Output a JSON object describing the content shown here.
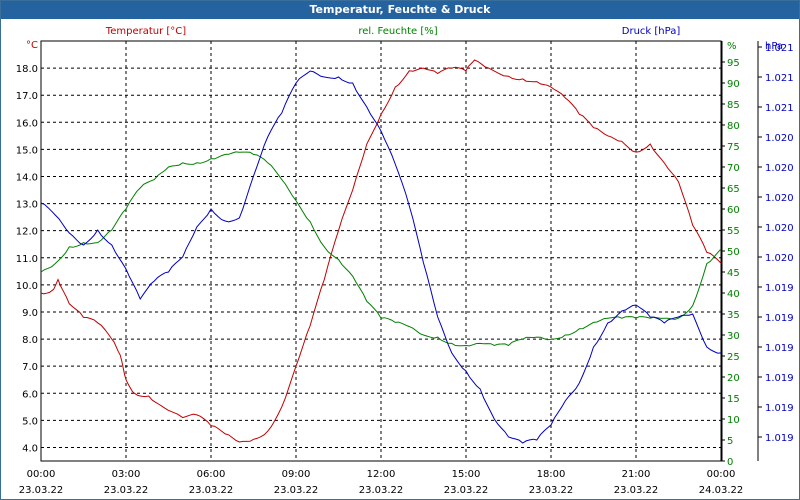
{
  "window": {
    "title": "Temperatur, Feuchte & Druck"
  },
  "chart_data": {
    "type": "line",
    "title": "Temperatur, Feuchte & Druck",
    "x_ticks": [
      {
        "time": "00:00",
        "date": "23.03.22"
      },
      {
        "time": "03:00",
        "date": "23.03.22"
      },
      {
        "time": "06:00",
        "date": "23.03.22"
      },
      {
        "time": "09:00",
        "date": "23.03.22"
      },
      {
        "time": "12:00",
        "date": "23.03.22"
      },
      {
        "time": "15:00",
        "date": "23.03.22"
      },
      {
        "time": "18:00",
        "date": "23.03.22"
      },
      {
        "time": "21:00",
        "date": "23.03.22"
      },
      {
        "time": "00:00",
        "date": "24.03.22"
      }
    ],
    "x_range_hours": [
      0,
      24
    ],
    "axes": {
      "temperature": {
        "unit_label": "°C",
        "ticks": [
          "4.0",
          "5.0",
          "6.0",
          "7.0",
          "8.0",
          "9.0",
          "10.0",
          "11.0",
          "12.0",
          "13.0",
          "14.0",
          "15.0",
          "16.0",
          "17.0",
          "18.0"
        ],
        "range": [
          3.5,
          19.0
        ]
      },
      "humidity": {
        "unit_label": "%",
        "ticks": [
          "0",
          "5",
          "10",
          "15",
          "20",
          "25",
          "30",
          "35",
          "40",
          "45",
          "50",
          "55",
          "60",
          "65",
          "70",
          "75",
          "80",
          "85",
          "90",
          "95"
        ],
        "range": [
          0,
          100
        ]
      },
      "pressure": {
        "unit_label": "hPa",
        "ticks": [
          "1.019",
          "1.019",
          "1.019",
          "1.019",
          "1.019",
          "1.019",
          "1.020",
          "1.020",
          "1.020",
          "1.020",
          "1.020",
          "1.021",
          "1.021",
          "1.021"
        ],
        "range": [
          0,
          14
        ]
      }
    },
    "series": [
      {
        "name": "Temperatur [°C]",
        "color": "#c00000",
        "axis": "temperature",
        "points": [
          [
            0,
            9.7
          ],
          [
            0.4,
            9.8
          ],
          [
            0.6,
            10.2
          ],
          [
            1.0,
            9.3
          ],
          [
            1.5,
            8.8
          ],
          [
            2.0,
            8.6
          ],
          [
            2.5,
            8.0
          ],
          [
            2.8,
            7.4
          ],
          [
            3.0,
            6.5
          ],
          [
            3.3,
            6.0
          ],
          [
            3.8,
            5.9
          ],
          [
            4.3,
            5.5
          ],
          [
            5.0,
            5.1
          ],
          [
            5.5,
            5.2
          ],
          [
            6.0,
            4.8
          ],
          [
            6.5,
            4.5
          ],
          [
            7.0,
            4.2
          ],
          [
            7.5,
            4.3
          ],
          [
            8.0,
            4.6
          ],
          [
            8.5,
            5.5
          ],
          [
            9.0,
            7.0
          ],
          [
            9.5,
            8.5
          ],
          [
            10.0,
            10.2
          ],
          [
            10.5,
            12.0
          ],
          [
            11.0,
            13.5
          ],
          [
            11.5,
            15.2
          ],
          [
            12.0,
            16.3
          ],
          [
            12.5,
            17.3
          ],
          [
            13.0,
            17.9
          ],
          [
            13.5,
            18.0
          ],
          [
            14.0,
            17.8
          ],
          [
            14.5,
            18.0
          ],
          [
            15.0,
            17.9
          ],
          [
            15.3,
            18.3
          ],
          [
            15.8,
            18.0
          ],
          [
            16.5,
            17.7
          ],
          [
            17.0,
            17.6
          ],
          [
            17.5,
            17.5
          ],
          [
            18.0,
            17.3
          ],
          [
            18.5,
            16.9
          ],
          [
            19.0,
            16.3
          ],
          [
            19.5,
            15.8
          ],
          [
            20.0,
            15.5
          ],
          [
            20.5,
            15.3
          ],
          [
            21.0,
            14.9
          ],
          [
            21.5,
            15.2
          ],
          [
            22.0,
            14.5
          ],
          [
            22.5,
            13.8
          ],
          [
            23.0,
            12.2
          ],
          [
            23.5,
            11.2
          ],
          [
            24.0,
            10.8
          ]
        ]
      },
      {
        "name": "rel. Feuchte [%]",
        "color": "#008000",
        "axis": "humidity",
        "points": [
          [
            0,
            45
          ],
          [
            0.5,
            47
          ],
          [
            1.0,
            51
          ],
          [
            1.5,
            52
          ],
          [
            2.0,
            52
          ],
          [
            2.5,
            55
          ],
          [
            3.0,
            60
          ],
          [
            3.5,
            65
          ],
          [
            4.0,
            67
          ],
          [
            4.5,
            70
          ],
          [
            5.0,
            71
          ],
          [
            5.5,
            71
          ],
          [
            6.0,
            72
          ],
          [
            6.5,
            73
          ],
          [
            7.0,
            73.5
          ],
          [
            7.5,
            73
          ],
          [
            8.0,
            71
          ],
          [
            8.5,
            67
          ],
          [
            9.0,
            62
          ],
          [
            9.5,
            57
          ],
          [
            10.0,
            51
          ],
          [
            10.5,
            48
          ],
          [
            11.0,
            44
          ],
          [
            11.5,
            38
          ],
          [
            12.0,
            34
          ],
          [
            12.5,
            33
          ],
          [
            13.0,
            32
          ],
          [
            13.5,
            30
          ],
          [
            14.0,
            29.5
          ],
          [
            14.5,
            28
          ],
          [
            15.0,
            27.5
          ],
          [
            15.5,
            28
          ],
          [
            16.0,
            27.5
          ],
          [
            16.5,
            27.5
          ],
          [
            17.0,
            29
          ],
          [
            17.5,
            29.5
          ],
          [
            18.0,
            29
          ],
          [
            18.5,
            30
          ],
          [
            19.0,
            31.5
          ],
          [
            19.5,
            33
          ],
          [
            20.0,
            34
          ],
          [
            20.5,
            34
          ],
          [
            21.0,
            34
          ],
          [
            21.5,
            34
          ],
          [
            22.0,
            34
          ],
          [
            22.5,
            34
          ],
          [
            23.0,
            37
          ],
          [
            23.5,
            47
          ],
          [
            24.0,
            50.5
          ]
        ]
      },
      {
        "name": "Druck [hPa]",
        "color": "#0000c0",
        "axis": "pressure",
        "points": [
          [
            0,
            8.6
          ],
          [
            0.5,
            8.2
          ],
          [
            1.0,
            7.6
          ],
          [
            1.5,
            7.2
          ],
          [
            2.0,
            7.7
          ],
          [
            2.5,
            7.2
          ],
          [
            3.0,
            6.4
          ],
          [
            3.5,
            5.4
          ],
          [
            4.0,
            6.0
          ],
          [
            4.5,
            6.3
          ],
          [
            5.0,
            6.8
          ],
          [
            5.5,
            7.8
          ],
          [
            6.0,
            8.4
          ],
          [
            6.5,
            8.0
          ],
          [
            7.0,
            8.1
          ],
          [
            7.5,
            9.5
          ],
          [
            8.0,
            10.8
          ],
          [
            8.5,
            11.6
          ],
          [
            9.0,
            12.6
          ],
          [
            9.5,
            13.0
          ],
          [
            10.0,
            12.8
          ],
          [
            10.5,
            12.8
          ],
          [
            11.0,
            12.6
          ],
          [
            11.5,
            11.8
          ],
          [
            12.0,
            11.0
          ],
          [
            12.5,
            9.9
          ],
          [
            13.0,
            8.5
          ],
          [
            13.5,
            6.6
          ],
          [
            14.0,
            4.8
          ],
          [
            14.5,
            3.6
          ],
          [
            15.0,
            3.0
          ],
          [
            15.5,
            2.4
          ],
          [
            16.0,
            1.4
          ],
          [
            16.5,
            0.8
          ],
          [
            17.0,
            0.6
          ],
          [
            17.5,
            0.7
          ],
          [
            18.0,
            1.2
          ],
          [
            18.5,
            2.0
          ],
          [
            19.0,
            2.6
          ],
          [
            19.5,
            3.8
          ],
          [
            20.0,
            4.6
          ],
          [
            20.5,
            5.0
          ],
          [
            21.0,
            5.2
          ],
          [
            21.5,
            4.8
          ],
          [
            22.0,
            4.6
          ],
          [
            22.5,
            4.8
          ],
          [
            23.0,
            4.9
          ],
          [
            23.5,
            3.8
          ],
          [
            24.0,
            3.6
          ]
        ]
      }
    ],
    "grid": true,
    "legend": "top"
  }
}
